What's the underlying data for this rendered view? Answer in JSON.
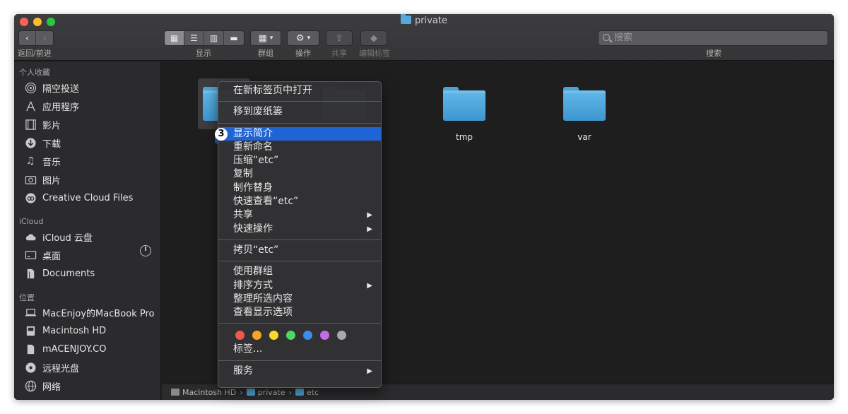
{
  "window": {
    "title": "private"
  },
  "toolbar": {
    "nav_label": "返回/前进",
    "view_label": "显示",
    "group_label": "群组",
    "action_label": "操作",
    "share_label": "共享",
    "edit_tags_label": "编辑标签",
    "search_placeholder": "搜索",
    "search_label": "搜索"
  },
  "sidebar": {
    "favorites_header": "个人收藏",
    "favorites": [
      {
        "label": "隔空投送",
        "icon": "airdrop-icon"
      },
      {
        "label": "应用程序",
        "icon": "applications-icon"
      },
      {
        "label": "影片",
        "icon": "movies-icon"
      },
      {
        "label": "下载",
        "icon": "downloads-icon"
      },
      {
        "label": "音乐",
        "icon": "music-icon"
      },
      {
        "label": "图片",
        "icon": "pictures-icon"
      },
      {
        "label": "Creative Cloud Files",
        "icon": "creative-cloud-icon"
      }
    ],
    "icloud_header": "iCloud",
    "icloud": [
      {
        "label": "iCloud 云盘",
        "icon": "cloud-icon"
      },
      {
        "label": "桌面",
        "icon": "desktop-icon"
      },
      {
        "label": "Documents",
        "icon": "document-icon"
      }
    ],
    "locations_header": "位置",
    "locations": [
      {
        "label": "MacEnjoy的MacBook Pro",
        "icon": "laptop-icon"
      },
      {
        "label": "Macintosh HD",
        "icon": "disk-icon"
      },
      {
        "label": "mACENJOY.CO",
        "icon": "file-icon"
      },
      {
        "label": "远程光盘",
        "icon": "optical-disc-icon"
      },
      {
        "label": "网络",
        "icon": "network-icon"
      }
    ]
  },
  "files": [
    {
      "name": "etc",
      "selected": true
    },
    {
      "name": "",
      "selected": false
    },
    {
      "name": "tmp",
      "selected": false
    },
    {
      "name": "var",
      "selected": false
    }
  ],
  "pathbar": [
    "Macintosh HD",
    "private",
    "etc"
  ],
  "context_menu": {
    "open_new_tab": "在新标签页中打开",
    "move_to_trash": "移到废纸篓",
    "badge": "3",
    "get_info": "显示简介",
    "rename": "重新命名",
    "compress": "压缩“etc”",
    "duplicate": "复制",
    "make_alias": "制作替身",
    "quick_look": "快速查看“etc”",
    "share": "共享",
    "quick_actions": "快速操作",
    "copy": "拷贝“etc”",
    "use_groups": "使用群组",
    "sort_by": "排序方式",
    "clean_up": "整理所选内容",
    "show_view_options": "查看显示选项",
    "tag_colors": [
      "#f0574f",
      "#f5a623",
      "#f8d92b",
      "#4cd964",
      "#3b8de8",
      "#c66be3",
      "#a9a9aa"
    ],
    "tags": "标签...",
    "services": "服务",
    "submenu_arrow": "▶"
  }
}
